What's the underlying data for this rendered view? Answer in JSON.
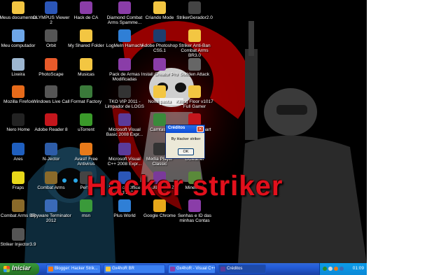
{
  "desktop": {
    "banner": "Hacker striker",
    "icons": [
      {
        "label": "Meus documentos",
        "icon": "folder-icon",
        "color": "#f3c642"
      },
      {
        "label": "OLYMPUS Viewer 2",
        "icon": "camera-app-icon",
        "color": "#2b56b8"
      },
      {
        "label": "Hack de CA",
        "icon": "archive-icon",
        "color": "#8a3da8"
      },
      {
        "label": "Diamond Combat Arms Spamme...",
        "icon": "archive-icon",
        "color": "#8a3da8"
      },
      {
        "label": "Criando Mode",
        "icon": "folder-icon",
        "color": "#f3c642"
      },
      {
        "label": "StrikerGerador2.0",
        "icon": "app-icon",
        "color": "#444444"
      },
      {
        "label": "Meu computador",
        "icon": "computer-icon",
        "color": "#6ea6e8"
      },
      {
        "label": "Orbit",
        "icon": "orbit-icon",
        "color": "#555555"
      },
      {
        "label": "My Shared Folder",
        "icon": "folder-icon",
        "color": "#f3c642"
      },
      {
        "label": "LogMeIn Hamachi",
        "icon": "hamachi-icon",
        "color": "#2f7fd6"
      },
      {
        "label": "Adobe Photoshop CS5.1",
        "icon": "photoshop-icon",
        "color": "#1d3e6e"
      },
      {
        "label": "Striker Anti-Ban Combat Arms BR3.0",
        "icon": "folder-icon",
        "color": "#f3c642"
      },
      {
        "label": "Lixeira",
        "icon": "recycle-bin-icon",
        "color": "#9db6d0"
      },
      {
        "label": "PhotoScape",
        "icon": "photoscape-icon",
        "color": "#e85a2a"
      },
      {
        "label": "Musicas",
        "icon": "folder-icon",
        "color": "#f3c642"
      },
      {
        "label": "Pack de Armas Modificadas",
        "icon": "archive-icon",
        "color": "#8a3da8"
      },
      {
        "label": "Install Creator Pro",
        "icon": "installer-icon",
        "color": "#8a3da8"
      },
      {
        "label": "Sudden Attack",
        "icon": "game-icon",
        "color": "#666666"
      },
      {
        "label": "Mozilla Firefox",
        "icon": "firefox-icon",
        "color": "#e66a1a"
      },
      {
        "label": "Windows Live Call",
        "icon": "phone-icon",
        "color": "#555555"
      },
      {
        "label": "Format Factory",
        "icon": "format-factory-icon",
        "color": "#3a7a3a"
      },
      {
        "label": "TKO VIP 2011 - Limpador de LOGS",
        "icon": "app-icon",
        "color": "#333333"
      },
      {
        "label": "Nova pasta",
        "icon": "folder-icon",
        "color": "#f3c642"
      },
      {
        "label": "Killing Floor v1017 Full Gamer",
        "icon": "folder-icon",
        "color": "#f3c642"
      },
      {
        "label": "Nero Home",
        "icon": "nero-icon",
        "color": "#222222"
      },
      {
        "label": "Adobe Reader 8",
        "icon": "pdf-icon",
        "color": "#c4161c"
      },
      {
        "label": "uTorrent",
        "icon": "utorrent-icon",
        "color": "#3a9a2a"
      },
      {
        "label": "Microsoft Visual Basic 2008 Expr...",
        "icon": "visual-studio-icon",
        "color": "#5b3b9a"
      },
      {
        "label": "Camtasia",
        "icon": "camtasia-icon",
        "color": "#3a8a3a"
      },
      {
        "label": "Nero StartSmart",
        "icon": "nero-icon",
        "color": "#c4161c"
      },
      {
        "label": "Ares",
        "icon": "ares-icon",
        "color": "#1f5fbf"
      },
      {
        "label": "N-Jector",
        "icon": "window-icon",
        "color": "#2d5ca8"
      },
      {
        "label": "Avast! Free Antivirus",
        "icon": "avast-icon",
        "color": "#e87a1a"
      },
      {
        "label": "Microsoft Visual C++ 2008 Expr...",
        "icon": "visual-studio-icon",
        "color": "#5b3b9a"
      },
      {
        "label": "Media Player Classic",
        "icon": "media-player-icon",
        "color": "#333333"
      },
      {
        "label": "CCleaner",
        "icon": "ccleaner-icon",
        "color": "#c4161c"
      },
      {
        "label": "Fraps",
        "icon": "fraps-icon",
        "color": "#e8d81a"
      },
      {
        "label": "Combat Arms",
        "icon": "game-icon",
        "color": "#8a6a2a"
      },
      {
        "label": "Perf...",
        "icon": "app-icon",
        "color": "#444444"
      },
      {
        "label": "Microsoft Office Word 2003",
        "icon": "word-icon",
        "color": "#2b56b8"
      },
      {
        "label": "CPUID CPU-Z",
        "icon": "cpu-z-icon",
        "color": "#7a3a9a"
      },
      {
        "label": "Minecraft",
        "icon": "minecraft-icon",
        "color": "#5a8a3a"
      },
      {
        "label": "Combat Arms BR",
        "icon": "game-icon",
        "color": "#8a6a2a"
      },
      {
        "label": "Spyware Terminator 2012",
        "icon": "shield-icon",
        "color": "#3a6ab8"
      },
      {
        "label": "msn",
        "icon": "msn-icon",
        "color": "#3a9a3a"
      },
      {
        "label": "Plus World",
        "icon": "globe-icon",
        "color": "#2f7fd6"
      },
      {
        "label": "Google Chrome",
        "icon": "chrome-icon",
        "color": "#e8a81a"
      },
      {
        "label": "Senhas e ID das minhas Contas",
        "icon": "archive-icon",
        "color": "#8a3da8"
      },
      {
        "label": "Striker Injector3.9",
        "icon": "app-icon",
        "color": "#555555"
      }
    ]
  },
  "dialog": {
    "title": "Créditos",
    "close_glyph": "✕",
    "message": "By Hacker striker",
    "ok_label": "OK"
  },
  "taskbar": {
    "start_label": "Iniciar",
    "tasks": [
      {
        "label": "Blogger: Hacker Strik...",
        "icon_color": "#f07a1a",
        "active": false
      },
      {
        "label": "Gx4hoR BR",
        "icon_color": "#f3c642",
        "active": false
      },
      {
        "label": "Gx4hoR - Visual C++ ...",
        "icon_color": "#8a3da8",
        "active": false
      },
      {
        "label": "Créditos",
        "icon_color": "#5b3b9a",
        "active": true
      }
    ],
    "tray_colors": [
      "#2a8a2a",
      "#d8d8d8",
      "#e87a1a",
      "#3a6ab8"
    ],
    "clock": "01:09"
  }
}
